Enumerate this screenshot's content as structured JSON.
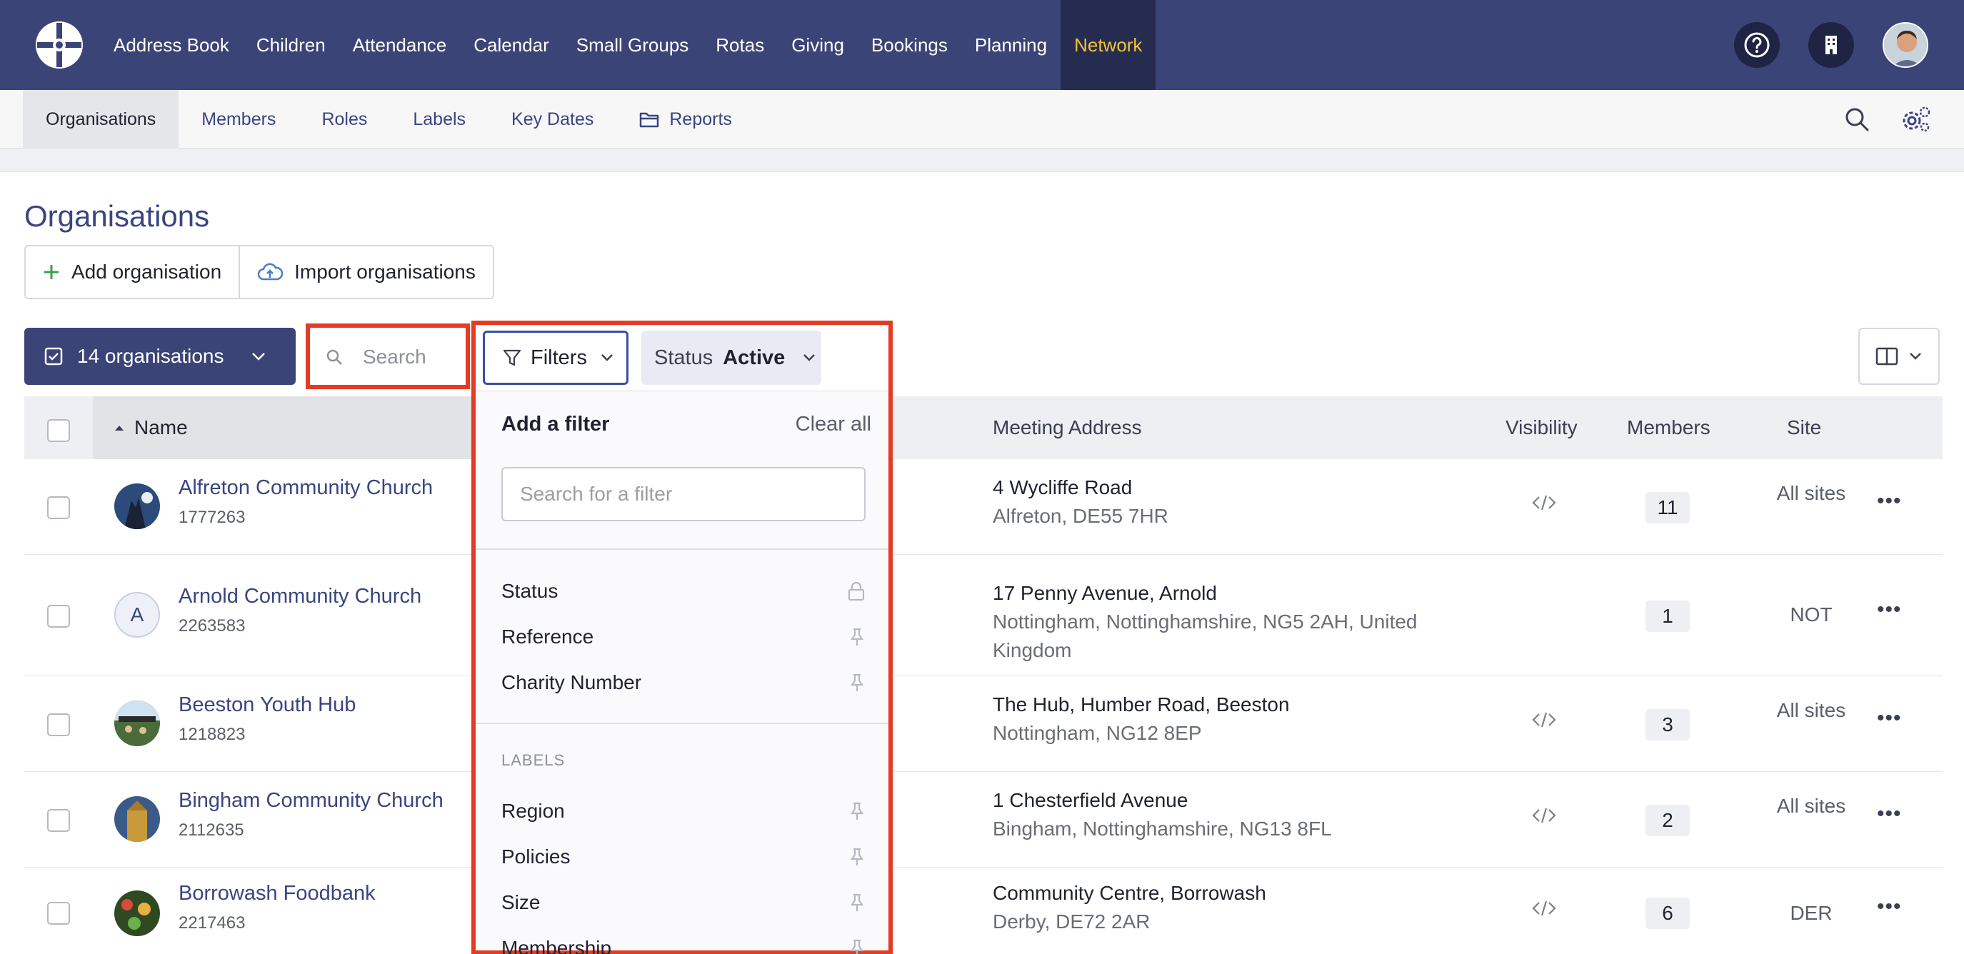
{
  "nav": {
    "items": [
      "Address Book",
      "Children",
      "Attendance",
      "Calendar",
      "Small Groups",
      "Rotas",
      "Giving",
      "Bookings",
      "Planning",
      "Network"
    ],
    "active": "Network"
  },
  "subnav": {
    "items": [
      "Organisations",
      "Members",
      "Roles",
      "Labels",
      "Key Dates",
      "Reports"
    ],
    "active": "Organisations"
  },
  "page": {
    "title": "Organisations",
    "add_button": "Add organisation",
    "import_button": "Import organisations",
    "selection_button": "14 organisations",
    "search_placeholder": "Search"
  },
  "filters": {
    "button_label": "Filters",
    "status_key": "Status",
    "status_value": "Active",
    "dropdown_title": "Add a filter",
    "clear_all": "Clear all",
    "search_placeholder": "Search for a filter",
    "items": [
      "Status",
      "Reference",
      "Charity Number"
    ],
    "labels_section": "LABELS",
    "label_items": [
      "Region",
      "Policies",
      "Size",
      "Membership"
    ]
  },
  "table": {
    "headers": {
      "name": "Name",
      "address": "Meeting Address",
      "visibility": "Visibility",
      "members": "Members",
      "site": "Site"
    },
    "rows": [
      {
        "name": "Alfreton Community Church",
        "ref": "1777263",
        "addr1": "4 Wycliffe Road",
        "addr2": "Alfreton, DE55 7HR",
        "members": "11",
        "site": "All sites",
        "avatar": "image",
        "visibility": "embed"
      },
      {
        "name": "Arnold Community Church",
        "ref": "2263583",
        "addr1": "17 Penny Avenue, Arnold",
        "addr2": "Nottingham, Nottinghamshire, NG5 2AH, United Kingdom",
        "members": "1",
        "site": "NOT",
        "avatar": "A",
        "visibility": ""
      },
      {
        "name": "Beeston Youth Hub",
        "ref": "1218823",
        "addr1": "The Hub, Humber Road, Beeston",
        "addr2": "Nottingham, NG12 8EP",
        "members": "3",
        "site": "All sites",
        "avatar": "image",
        "visibility": "embed"
      },
      {
        "name": "Bingham Community Church",
        "ref": "2112635",
        "addr1": "1 Chesterfield Avenue",
        "addr2": "Bingham, Nottinghamshire, NG13 8FL",
        "members": "2",
        "site": "All sites",
        "avatar": "image",
        "visibility": "embed"
      },
      {
        "name": "Borrowash Foodbank",
        "ref": "2217463",
        "addr1": "Community Centre, Borrowash",
        "addr2": "Derby, DE72 2AR",
        "members": "6",
        "site": "DER",
        "avatar": "image",
        "visibility": "embed"
      }
    ]
  },
  "colors": {
    "nav_bg": "#3b4477",
    "accent": "#3a4580",
    "active_nav_text": "#f2c33a",
    "highlight": "#e53a23"
  }
}
